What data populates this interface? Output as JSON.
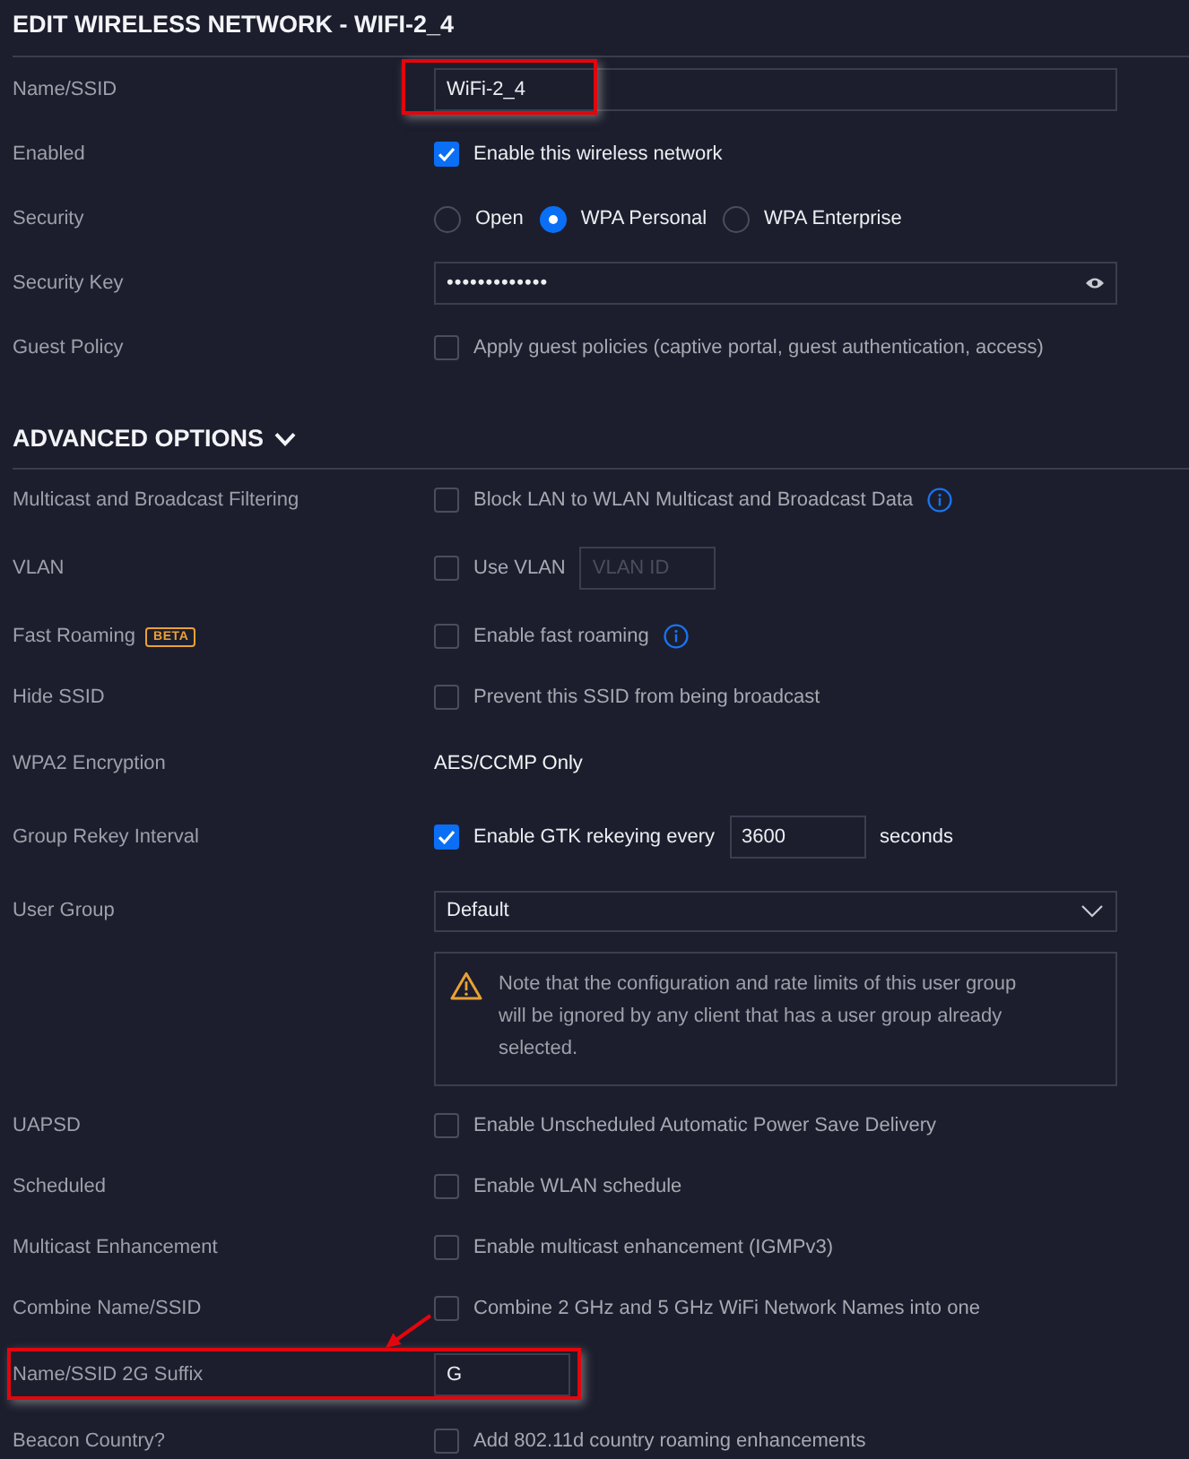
{
  "title": "EDIT WIRELESS NETWORK - WIFI-2_4",
  "general": [
    {
      "kind": "text",
      "label": "Name/SSID",
      "value": "WiFi-2_4",
      "highlighted": true
    },
    {
      "kind": "checkbox",
      "label": "Enabled",
      "checked": true,
      "text": "Enable this wireless network"
    },
    {
      "kind": "radio",
      "label": "Security",
      "options": [
        {
          "label": "Open",
          "selected": false
        },
        {
          "label": "WPA Personal",
          "selected": true
        },
        {
          "label": "WPA Enterprise",
          "selected": false
        }
      ]
    },
    {
      "kind": "password",
      "label": "Security Key",
      "value": "•••••••••••••"
    },
    {
      "kind": "checkbox",
      "label": "Guest Policy",
      "checked": false,
      "text": "Apply guest policies (captive portal, guest authentication, access)"
    }
  ],
  "advanced": {
    "title": "ADVANCED OPTIONS",
    "expanded": true,
    "rows": [
      {
        "kind": "checkbox",
        "label": "Multicast and Broadcast Filtering",
        "checked": false,
        "text": "Block LAN to WLAN Multicast and Broadcast Data",
        "info": true
      },
      {
        "kind": "checkbox_field",
        "label": "VLAN",
        "checked": false,
        "text": "Use VLAN",
        "placeholder": "VLAN ID"
      },
      {
        "kind": "checkbox",
        "label": "Fast Roaming",
        "badge": "BETA",
        "checked": false,
        "text": "Enable fast roaming",
        "info": true
      },
      {
        "kind": "checkbox",
        "label": "Hide SSID",
        "checked": false,
        "text": "Prevent this SSID from being broadcast"
      },
      {
        "kind": "static",
        "label": "WPA2 Encryption",
        "value": "AES/CCMP Only"
      },
      {
        "kind": "checkbox_field",
        "label": "Group Rekey Interval",
        "checked": true,
        "text": "Enable GTK rekeying every",
        "value": "3600",
        "unit": "seconds"
      },
      {
        "kind": "select",
        "label": "User Group",
        "value": "Default"
      },
      {
        "kind": "note",
        "text": "Note that the configuration and rate limits of this user group will be ignored by any client that has a user group already selected."
      },
      {
        "kind": "checkbox",
        "label": "UAPSD",
        "checked": false,
        "text": "Enable Unscheduled Automatic Power Save Delivery"
      },
      {
        "kind": "checkbox",
        "label": "Scheduled",
        "checked": false,
        "text": "Enable WLAN schedule"
      },
      {
        "kind": "checkbox",
        "label": "Multicast Enhancement",
        "checked": false,
        "text": "Enable multicast enhancement (IGMPv3)"
      },
      {
        "kind": "checkbox",
        "label": "Combine Name/SSID",
        "checked": false,
        "text": "Combine 2 GHz and 5 GHz WiFi Network Names into one"
      },
      {
        "kind": "short_text",
        "label": "Name/SSID 2G Suffix",
        "value": "G",
        "highlighted": true,
        "arrow": true
      },
      {
        "kind": "checkbox",
        "label": "Beacon Country?",
        "checked": false,
        "text": "Add 802.11d country roaming enhancements"
      }
    ]
  }
}
